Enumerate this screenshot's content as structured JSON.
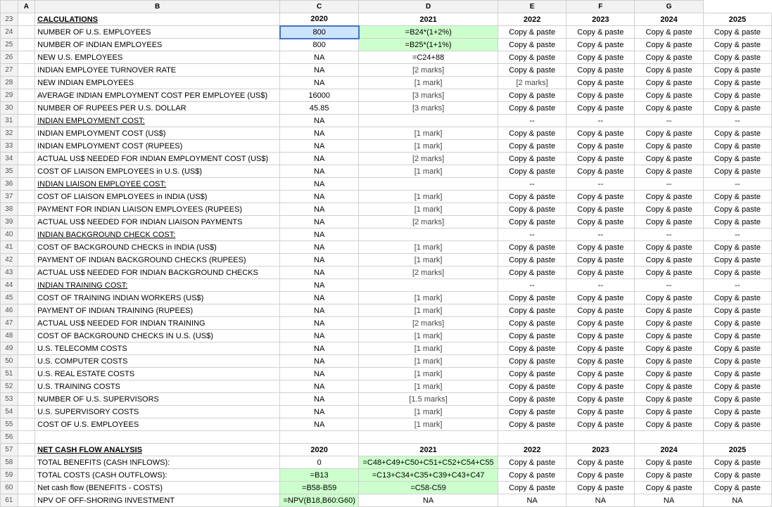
{
  "rows": [
    {
      "num": 23,
      "label": "CALCULATIONS",
      "labelStyle": "section-header",
      "col2020": "2020",
      "col2021": "2021",
      "col2022": "2022",
      "col2023": "2023",
      "col2024": "2024",
      "col2025": "2025",
      "isHeader": true
    },
    {
      "num": 24,
      "label": "NUMBER OF U.S. EMPLOYEES",
      "col2020": "800",
      "col2020style": "input",
      "col2021": "=B24*(1+2%)",
      "col2021style": "formula",
      "col2022": "Copy & paste",
      "col2023": "Copy & paste",
      "col2024": "Copy & paste",
      "col2025": "Copy & paste"
    },
    {
      "num": 25,
      "label": "NUMBER OF INDIAN EMPLOYEES",
      "col2020": "800",
      "col2021": "=B25*(1+1%)",
      "col2021style": "formula",
      "col2022": "Copy & paste",
      "col2023": "Copy & paste",
      "col2024": "Copy & paste",
      "col2025": "Copy & paste"
    },
    {
      "num": 26,
      "label": "NEW U.S. EMPLOYEES",
      "col2020": "",
      "col2020na": "NA",
      "col2021": "=C24+88",
      "col2022": "Copy & paste",
      "col2023": "Copy & paste",
      "col2024": "Copy & paste",
      "col2025": "Copy & paste"
    },
    {
      "num": 27,
      "label": "INDIAN EMPLOYEE TURNOVER RATE",
      "col2020na": "NA",
      "col2021": "[2 marks]",
      "col2021style": "marks",
      "col2022": "Copy & paste",
      "col2023": "Copy & paste",
      "col2024": "Copy & paste",
      "col2025": "Copy & paste"
    },
    {
      "num": 28,
      "label": "NEW INDIAN EMPLOYEES",
      "col2020na": "NA",
      "col2021": "[1 mark]",
      "col2021style": "marks",
      "col2022": "[2 marks]",
      "col2022style": "marks",
      "col2023": "Copy & paste",
      "col2024": "Copy & paste",
      "col2025": "Copy & paste"
    },
    {
      "num": 29,
      "label": "AVERAGE INDIAN EMPLOYMENT COST PER EMPLOYEE (US$)",
      "col2020": "16000",
      "col2021": "[3 marks]",
      "col2021style": "marks",
      "col2022": "Copy & paste",
      "col2023": "Copy & paste",
      "col2024": "Copy & paste",
      "col2025": "Copy & paste"
    },
    {
      "num": 30,
      "label": "NUMBER OF RUPEES PER U.S. DOLLAR",
      "col2020": "45.85",
      "col2021": "[3 marks]",
      "col2021style": "marks",
      "col2022": "Copy & paste",
      "col2023": "Copy & paste",
      "col2024": "Copy & paste",
      "col2025": "Copy & paste"
    },
    {
      "num": 31,
      "label": "INDIAN EMPLOYMENT COST:",
      "labelStyle": "underline",
      "col2020na": "NA",
      "col2021": "",
      "col2022dash": "--",
      "col2023": "",
      "col2023dash": "--",
      "col2024": "",
      "col2024dash": "--",
      "col2025": "",
      "col2025dash": "--"
    },
    {
      "num": 32,
      "label": "INDIAN EMPLOYMENT COST (US$)",
      "col2020na": "NA",
      "col2021": "[1 mark]",
      "col2021style": "marks",
      "col2022": "Copy & paste",
      "col2023": "Copy & paste",
      "col2024": "Copy & paste",
      "col2025": "Copy & paste"
    },
    {
      "num": 33,
      "label": "INDIAN EMPLOYMENT COST (RUPEES)",
      "col2020na": "NA",
      "col2021": "[1 mark]",
      "col2021style": "marks",
      "col2022": "Copy & paste",
      "col2023": "Copy & paste",
      "col2024": "Copy & paste",
      "col2025": "Copy & paste"
    },
    {
      "num": 34,
      "label": "ACTUAL US$ NEEDED FOR INDIAN EMPLOYMENT COST (US$)",
      "col2020na": "NA",
      "col2021": "[2 marks]",
      "col2021style": "marks",
      "col2022": "Copy & paste",
      "col2023": "Copy & paste",
      "col2024": "Copy & paste",
      "col2025": "Copy & paste"
    },
    {
      "num": 35,
      "label": "COST OF LIAISON EMPLOYEES in U.S. (US$)",
      "col2020na": "NA",
      "col2021": "[1 mark]",
      "col2021style": "marks",
      "col2022": "Copy & paste",
      "col2023": "Copy & paste",
      "col2024": "Copy & paste",
      "col2025": "Copy & paste"
    },
    {
      "num": 36,
      "label": "INDIAN LIAISON EMPLOYEE COST:",
      "labelStyle": "underline",
      "col2020na": "NA",
      "col2021": "",
      "col2022dash": "--",
      "col2023dash": "--",
      "col2024dash": "--",
      "col2025dash": "--"
    },
    {
      "num": 37,
      "label": "COST OF LIAISON EMPLOYEES in INDIA (US$)",
      "col2020na": "NA",
      "col2021": "[1 mark]",
      "col2021style": "marks",
      "col2022": "Copy & paste",
      "col2023": "Copy & paste",
      "col2024": "Copy & paste",
      "col2025": "Copy & paste"
    },
    {
      "num": 38,
      "label": "PAYMENT FOR INDIAN LIAISON EMPLOYEES (RUPEES)",
      "col2020na": "NA",
      "col2021": "[1 mark]",
      "col2021style": "marks",
      "col2022": "Copy & paste",
      "col2023": "Copy & paste",
      "col2024": "Copy & paste",
      "col2025": "Copy & paste"
    },
    {
      "num": 39,
      "label": "ACTUAL US$ NEEDED FOR INDIAN LIAISON PAYMENTS",
      "col2020na": "NA",
      "col2021": "[2 marks]",
      "col2021style": "marks",
      "col2022": "Copy & paste",
      "col2023": "Copy & paste",
      "col2024": "Copy & paste",
      "col2025": "Copy & paste"
    },
    {
      "num": 40,
      "label": "INDIAN BACKGROUND CHECK COST:",
      "labelStyle": "underline",
      "col2020na": "NA",
      "col2021": "",
      "col2022dash": "--",
      "col2023dash": "--",
      "col2024dash": "--",
      "col2025dash": "--"
    },
    {
      "num": 41,
      "label": "COST OF BACKGROUND CHECKS in INDIA (US$)",
      "col2020na": "NA",
      "col2021": "[1 mark]",
      "col2021style": "marks",
      "col2022": "Copy & paste",
      "col2023": "Copy & paste",
      "col2024": "Copy & paste",
      "col2025": "Copy & paste"
    },
    {
      "num": 42,
      "label": "PAYMENT OF INDIAN BACKGROUND CHECKS (RUPEES)",
      "col2020na": "NA",
      "col2021": "[1 mark]",
      "col2021style": "marks",
      "col2022": "Copy & paste",
      "col2023": "Copy & paste",
      "col2024": "Copy & paste",
      "col2025": "Copy & paste"
    },
    {
      "num": 43,
      "label": "ACTUAL US$ NEEDED FOR INDIAN BACKGROUND CHECKS",
      "col2020na": "NA",
      "col2021": "[2 marks]",
      "col2021style": "marks",
      "col2022": "Copy & paste",
      "col2023": "Copy & paste",
      "col2024": "Copy & paste",
      "col2025": "Copy & paste"
    },
    {
      "num": 44,
      "label": "INDIAN TRAINING COST:",
      "labelStyle": "underline",
      "col2020na": "NA",
      "col2021": "",
      "col2022dash": "--",
      "col2023dash": "--",
      "col2024dash": "--",
      "col2025dash": "--"
    },
    {
      "num": 45,
      "label": "COST OF TRAINING INDIAN WORKERS (US$)",
      "col2020na": "NA",
      "col2021": "[1 mark]",
      "col2021style": "marks",
      "col2022": "Copy & paste",
      "col2023": "Copy & paste",
      "col2024": "Copy & paste",
      "col2025": "Copy & paste"
    },
    {
      "num": 46,
      "label": "PAYMENT OF INDIAN TRAINING (RUPEES)",
      "col2020na": "NA",
      "col2021": "[1 mark]",
      "col2021style": "marks",
      "col2022": "Copy & paste",
      "col2023": "Copy & paste",
      "col2024": "Copy & paste",
      "col2025": "Copy & paste"
    },
    {
      "num": 47,
      "label": "ACTUAL US$ NEEDED FOR INDIAN TRAINING",
      "col2020na": "NA",
      "col2021": "[2 marks]",
      "col2021style": "marks",
      "col2022": "Copy & paste",
      "col2023": "Copy & paste",
      "col2024": "Copy & paste",
      "col2025": "Copy & paste"
    },
    {
      "num": 48,
      "label": "COST OF BACKGROUND CHECKS IN U.S. (US$)",
      "col2020na": "NA",
      "col2021": "[1 mark]",
      "col2021style": "marks",
      "col2022": "Copy & paste",
      "col2023": "Copy & paste",
      "col2024": "Copy & paste",
      "col2025": "Copy & paste"
    },
    {
      "num": 49,
      "label": "U.S. TELECOMM COSTS",
      "col2020na": "NA",
      "col2021": "[1 mark]",
      "col2021style": "marks",
      "col2022": "Copy & paste",
      "col2023": "Copy & paste",
      "col2024": "Copy & paste",
      "col2025": "Copy & paste"
    },
    {
      "num": 50,
      "label": "U.S. COMPUTER COSTS",
      "col2020na": "NA",
      "col2021": "[1 mark]",
      "col2021style": "marks",
      "col2022": "Copy & paste",
      "col2023": "Copy & paste",
      "col2024": "Copy & paste",
      "col2025": "Copy & paste"
    },
    {
      "num": 51,
      "label": "U.S. REAL ESTATE COSTS",
      "col2020na": "NA",
      "col2021": "[1 mark]",
      "col2021style": "marks",
      "col2022": "Copy & paste",
      "col2023": "Copy & paste",
      "col2024": "Copy & paste",
      "col2025": "Copy & paste"
    },
    {
      "num": 52,
      "label": "U.S. TRAINING COSTS",
      "col2020na": "NA",
      "col2021": "[1 mark]",
      "col2021style": "marks",
      "col2022": "Copy & paste",
      "col2023": "Copy & paste",
      "col2024": "Copy & paste",
      "col2025": "Copy & paste"
    },
    {
      "num": 53,
      "label": "NUMBER OF U.S. SUPERVISORS",
      "col2020na": "NA",
      "col2021": "[1.5 marks]",
      "col2021style": "marks",
      "col2022": "Copy & paste",
      "col2023": "Copy & paste",
      "col2024": "Copy & paste",
      "col2025": "Copy & paste"
    },
    {
      "num": 54,
      "label": "U.S. SUPERVISORY COSTS",
      "col2020na": "NA",
      "col2021": "[1 mark]",
      "col2021style": "marks",
      "col2022": "Copy & paste",
      "col2023": "Copy & paste",
      "col2024": "Copy & paste",
      "col2025": "Copy & paste"
    },
    {
      "num": 55,
      "label": "COST OF U.S. EMPLOYEES",
      "col2020na": "NA",
      "col2021": "[1 mark]",
      "col2021style": "marks",
      "col2022": "Copy & paste",
      "col2023": "Copy & paste",
      "col2024": "Copy & paste",
      "col2025": "Copy & paste"
    },
    {
      "num": 56,
      "label": "",
      "col2020": "",
      "col2021": "",
      "col2022": "",
      "col2023": "",
      "col2024": "",
      "col2025": ""
    },
    {
      "num": 57,
      "label": "NET CASH FLOW ANALYSIS",
      "labelStyle": "section-header",
      "col2020": "2020",
      "col2021": "2021",
      "col2022": "2022",
      "col2023": "2023",
      "col2024": "2024",
      "col2025": "2025",
      "isHeader": true
    },
    {
      "num": 58,
      "label": "TOTAL BENEFITS (CASH INFLOWS):",
      "col2020": "0",
      "col2021": "=C48+C49+C50+C51+C52+C54+C55",
      "col2021style": "formula",
      "col2022": "Copy & paste",
      "col2023": "Copy & paste",
      "col2024": "Copy & paste",
      "col2025": "Copy & paste"
    },
    {
      "num": 59,
      "label": "TOTAL COSTS (CASH OUTFLOWS):",
      "col2020": "=B13",
      "col2020style": "formula",
      "col2021": "=C13+C34+C35+C39+C43+C47",
      "col2021style": "formula",
      "col2022": "Copy & paste",
      "col2023": "Copy & paste",
      "col2024": "Copy & paste",
      "col2025": "Copy & paste"
    },
    {
      "num": 60,
      "label": "Net cash flow (BENEFITS - COSTS)",
      "col2020": "=B58-B59",
      "col2020style": "formula",
      "col2021": "=C58-C59",
      "col2021style": "formula",
      "col2022": "Copy & paste",
      "col2023": "Copy & paste",
      "col2024": "Copy & paste",
      "col2025": "Copy & paste"
    },
    {
      "num": 61,
      "label": "NPV OF OFF-SHORING INVESTMENT",
      "col2020": "=NPV(B18,B60:G60)",
      "col2020style": "formula",
      "col2021na": "NA",
      "col2022na": "NA",
      "col2023na": "NA",
      "col2024na": "NA",
      "col2025na": "NA"
    }
  ],
  "col_headers": [
    "",
    "A",
    "B",
    "C",
    "D",
    "E",
    "F",
    "G"
  ]
}
